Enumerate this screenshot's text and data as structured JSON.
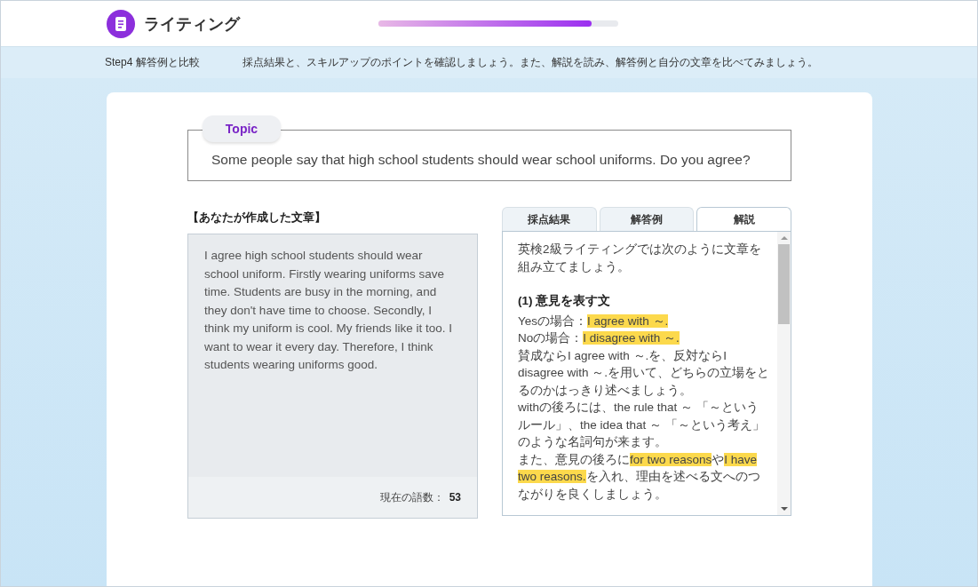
{
  "header": {
    "title": "ライティング",
    "progress": {
      "level": 0.89
    }
  },
  "step_bar": {
    "step": "Step4 解答例と比較",
    "instruction": "採点結果と、スキルアップのポイントを確認しましょう。また、解説を読み、解答例と自分の文章を比べてみましょう。"
  },
  "topic": {
    "label": "Topic",
    "question": "Some people say that high school students should wear school uniforms. Do you agree?"
  },
  "your_essay": {
    "heading": "【あなたが作成した文章】",
    "text": "I agree high school students should wear school uniform. Firstly wearing uniforms save time. Students are busy in the morning, and they don't have time to choose. Secondly, I think my uniform is cool. My friends like it too. I want to wear it every day. Therefore, I think students wearing uniforms good.",
    "word_count_label": "現在の語数：",
    "word_count": "53"
  },
  "tabs": [
    {
      "label": "採点結果",
      "selected": false
    },
    {
      "label": "解答例",
      "selected": false
    },
    {
      "label": "解説",
      "selected": true
    }
  ],
  "explanation": {
    "intro": "英検2級ライティングでは次のように文章を組み立てましょう。",
    "heading": "(1) 意見を表す文",
    "paragraphs": [
      [
        {
          "text": "Yesの場合：",
          "highlight": false
        },
        {
          "text": "I agree with ～.",
          "highlight": true
        }
      ],
      [
        {
          "text": "Noの場合：",
          "highlight": false
        },
        {
          "text": "I disagree with ～.",
          "highlight": true
        }
      ],
      [
        {
          "text": "賛成ならI agree with ～.を、反対ならI disagree with ～.を用いて、どちらの立場をとるのかはっきり述べましょう。",
          "highlight": false
        }
      ],
      [
        {
          "text": "withの後ろには、the rule that ～ 「～というルール」、the idea that ～ 「～という考え」のような名詞句が来ます。",
          "highlight": false
        }
      ],
      [
        {
          "text": "また、意見の後ろに",
          "highlight": false
        },
        {
          "text": "for two reasons",
          "highlight": true
        },
        {
          "text": "や",
          "highlight": false
        },
        {
          "text": "I have two reasons.",
          "highlight": true
        },
        {
          "text": "を入れ、理由を述べる文へのつながりを良くしましょう。",
          "highlight": false
        }
      ]
    ]
  }
}
